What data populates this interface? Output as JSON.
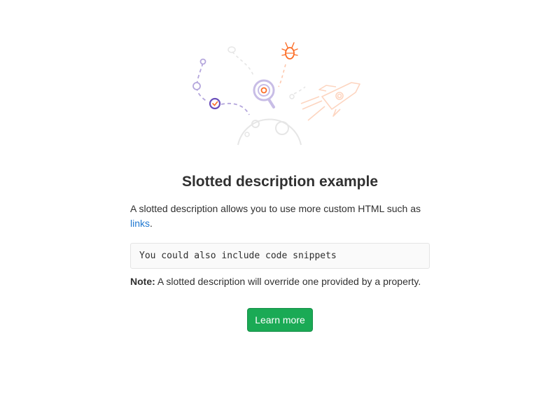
{
  "empty_state": {
    "illustration_icon": "empty-state-search-illustration",
    "title": "Slotted description example",
    "description": {
      "text_before_link": "A slotted description allows you to use more custom HTML such as ",
      "link_text": "links",
      "text_after_link": "."
    },
    "code_snippet": "You could also include code snippets",
    "note": {
      "label": "Note:",
      "text": " A slotted description will override one provided by a property."
    },
    "primary_button_label": "Learn more"
  },
  "colors": {
    "link": "#1f78d1",
    "button_bg": "#1aaa55",
    "illustration_purple": "#6b4fbb",
    "illustration_orange": "#fc6d26"
  }
}
